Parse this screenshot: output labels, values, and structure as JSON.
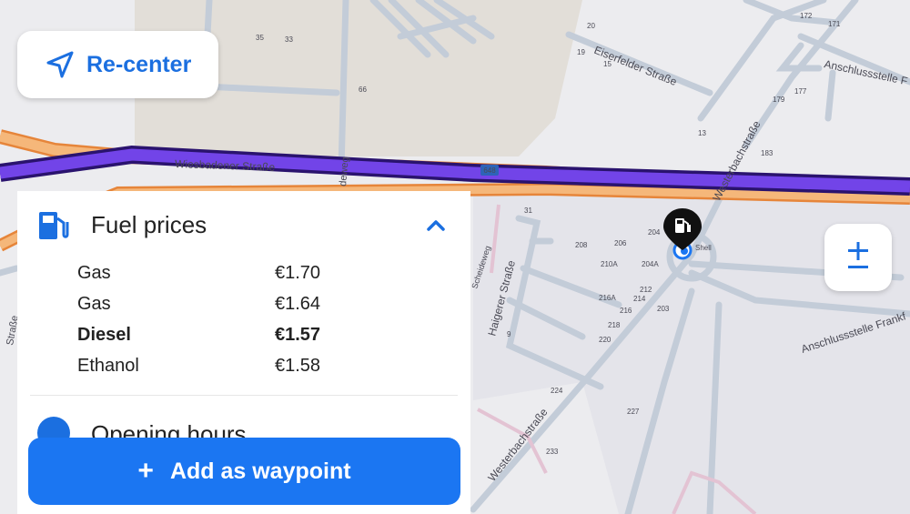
{
  "map": {
    "streets": {
      "wiesbadener": "Wiesbadener Straße",
      "eiserfelder": "Eiserfelder Straße",
      "westerbach_upper": "Westerbachstraße",
      "westerbach_lower": "Westerbachstraße",
      "haigerer": "Haigerer Straße",
      "anschluss_upper": "Anschlussstelle F",
      "anschluss_lower": "Anschlussstelle Frankf",
      "scheideweg": "Scheideweg",
      "deweg": "deweg",
      "strasse_left": "Straße"
    },
    "route_badge": "648",
    "poi_label": "Shell",
    "house_numbers": [
      "35",
      "33",
      "66",
      "20",
      "19",
      "15",
      "172",
      "171",
      "177",
      "179",
      "13",
      "183",
      "31",
      "208",
      "206",
      "204",
      "210A",
      "204A",
      "212",
      "216A",
      "214",
      "216",
      "203",
      "218",
      "220",
      "224",
      "227",
      "233",
      "9"
    ]
  },
  "recenter": {
    "label": "Re-center",
    "icon": "navigation-arrow-icon"
  },
  "zoom": {
    "icon": "zoom-plus-minus-icon"
  },
  "fuel_panel": {
    "title": "Fuel prices",
    "icon": "fuel-pump-icon",
    "collapse_icon": "chevron-up-icon",
    "prices": [
      {
        "name": "Gas",
        "price": "€1.70",
        "bold": false
      },
      {
        "name": "Gas",
        "price": "€1.64",
        "bold": false
      },
      {
        "name": "Diesel",
        "price": "€1.57",
        "bold": true
      },
      {
        "name": "Ethanol",
        "price": "€1.58",
        "bold": false
      }
    ],
    "next_section_label": "Opening hours"
  },
  "add_waypoint": {
    "label": "Add as waypoint",
    "icon": "plus-icon"
  },
  "colors": {
    "accent": "#1b6fe0",
    "button": "#1b76f2",
    "route": "#6a33e0",
    "highway": "#f2a25c"
  }
}
